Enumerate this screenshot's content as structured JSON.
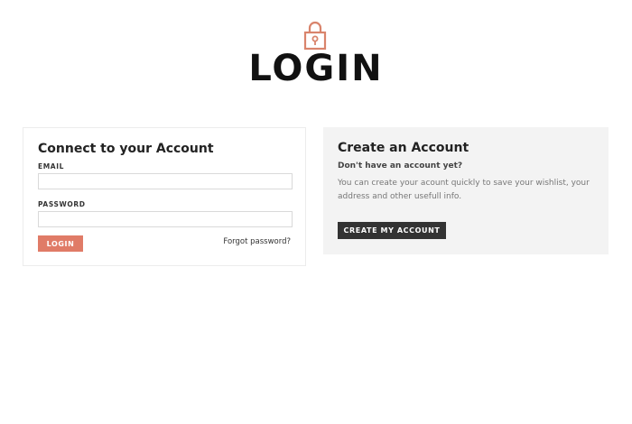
{
  "header": {
    "title": "LOGIN",
    "icon": "lock-icon",
    "accent_color": "#d9846c"
  },
  "login_panel": {
    "title": "Connect to your Account",
    "email_label": "EMAIL",
    "email_value": "",
    "password_label": "PASSWORD",
    "password_value": "",
    "login_button": "LOGIN",
    "login_button_color": "#e07b67",
    "forgot_link": "Forgot password?"
  },
  "create_panel": {
    "title": "Create an Account",
    "subheading": "Don't have an account yet?",
    "description": "You can create your acount quickly to save your wishlist, your address and other usefull info.",
    "create_button": "CREATE MY ACCOUNT",
    "create_button_color": "#333333",
    "background_color": "#f3f3f3"
  }
}
